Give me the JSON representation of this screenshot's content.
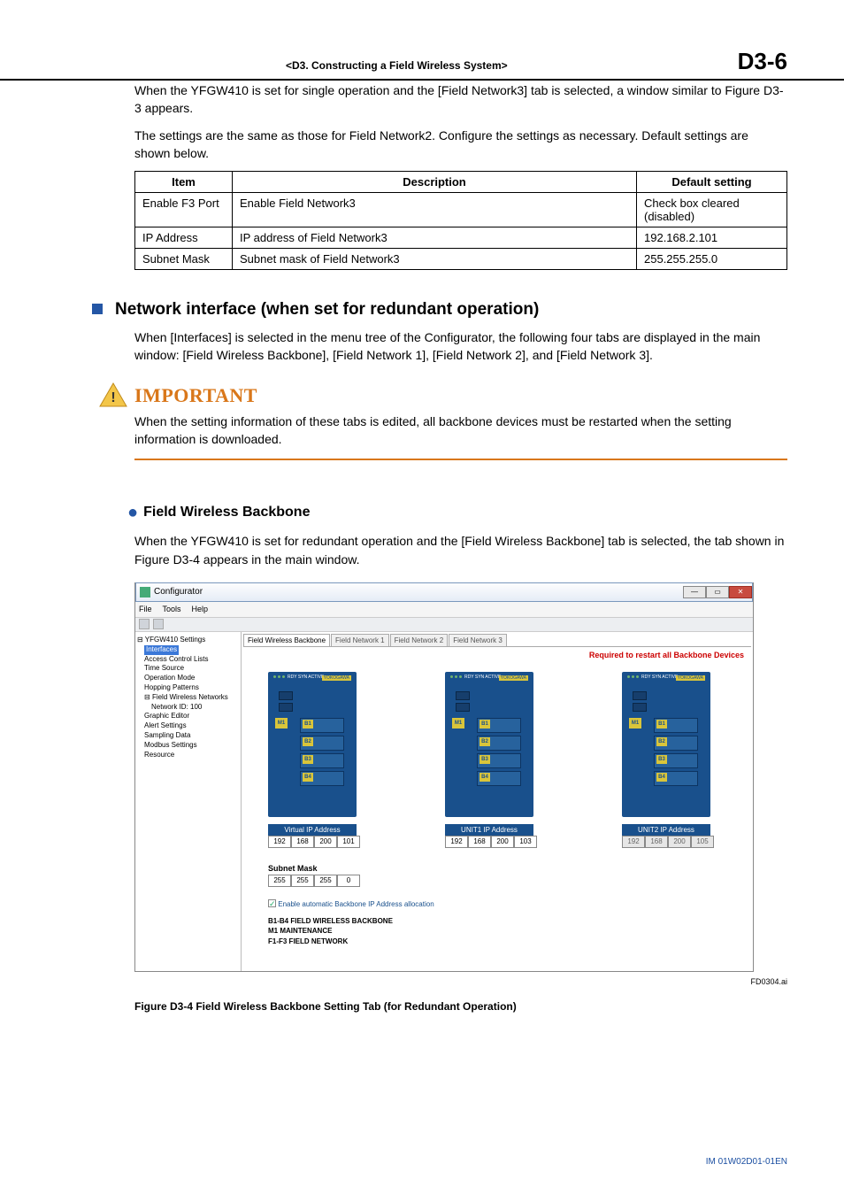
{
  "header": {
    "chapter": "<D3.  Constructing a Field Wireless System>",
    "page": "D3-6"
  },
  "intro": {
    "p1": "When the YFGW410 is set for single operation and the [Field Network3] tab is selected, a window similar to Figure D3-3 appears.",
    "p2": "The settings are the same as those for Field Network2. Configure the settings as necessary. Default settings are shown below."
  },
  "table": {
    "headers": {
      "c1": "Item",
      "c2": "Description",
      "c3": "Default setting"
    },
    "rows": [
      {
        "c1": "Enable F3 Port",
        "c2": "Enable Field Network3",
        "c3": "Check box cleared (disabled)"
      },
      {
        "c1": "IP Address",
        "c2": "IP address of Field Network3",
        "c3": "192.168.2.101"
      },
      {
        "c1": "Subnet Mask",
        "c2": "Subnet mask of Field Network3",
        "c3": "255.255.255.0"
      }
    ]
  },
  "section1": {
    "title": "Network interface (when set for redundant operation)",
    "body": "When [Interfaces] is selected in the menu tree of the Configurator, the following four tabs are displayed in the main window: [Field Wireless Backbone], [Field Network 1], [Field Network 2], and [Field Network 3]."
  },
  "important": {
    "label": "IMPORTANT",
    "body": "When the setting information of these tabs is edited, all backbone devices must be restarted when the setting information is downloaded."
  },
  "section2": {
    "title": "Field Wireless Backbone",
    "body": "When the YFGW410 is set for redundant operation and the [Field Wireless Backbone] tab is selected, the tab shown in Figure D3-4 appears in the main window."
  },
  "screenshot": {
    "window_title": "Configurator",
    "menus": [
      "File",
      "Tools",
      "Help"
    ],
    "tree": {
      "root": "YFGW410 Settings",
      "selected": "Interfaces",
      "items": [
        "Access Control Lists",
        "Time Source",
        "Operation Mode",
        "Hopping Patterns",
        "Field Wireless Networks",
        "Network ID: 100",
        "Graphic Editor",
        "Alert Settings",
        "Sampling Data",
        "Modbus Settings",
        "Resource"
      ]
    },
    "tabs": [
      "Field Wireless Backbone",
      "Field Network 1",
      "Field Network 2",
      "Field Network 3"
    ],
    "warning": "Required to restart all Backbone Devices",
    "device_top_label": "RDY SYN ACTIVE",
    "brand": "YOKOGAWA",
    "m_label": "M1",
    "slot_labels": [
      "B1",
      "B2",
      "B3",
      "B4"
    ],
    "ip_sections": [
      {
        "label": "Virtual IP Address",
        "octets": [
          "192",
          "168",
          "200",
          "101"
        ],
        "readonly": [
          false,
          false,
          false,
          false
        ]
      },
      {
        "label": "UNIT1 IP Address",
        "octets": [
          "192",
          "168",
          "200",
          "103"
        ],
        "readonly": [
          false,
          false,
          false,
          false
        ]
      },
      {
        "label": "UNIT2 IP Address",
        "octets": [
          "192",
          "168",
          "200",
          "105"
        ],
        "readonly": [
          true,
          true,
          true,
          true
        ]
      }
    ],
    "subnet": {
      "label": "Subnet Mask",
      "octets": [
        "255",
        "255",
        "255",
        "0"
      ]
    },
    "checkbox_label": "Enable automatic Backbone IP Address allocation",
    "legend": [
      "B1-B4 FIELD WIRELESS BACKBONE",
      "M1    MAINTENANCE",
      "F1-F3 FIELD NETWORK"
    ]
  },
  "figure": {
    "ref": "FD0304.ai",
    "caption": "Figure D3-4  Field Wireless Backbone Setting Tab (for Redundant Operation)"
  },
  "footer": "IM 01W02D01-01EN"
}
